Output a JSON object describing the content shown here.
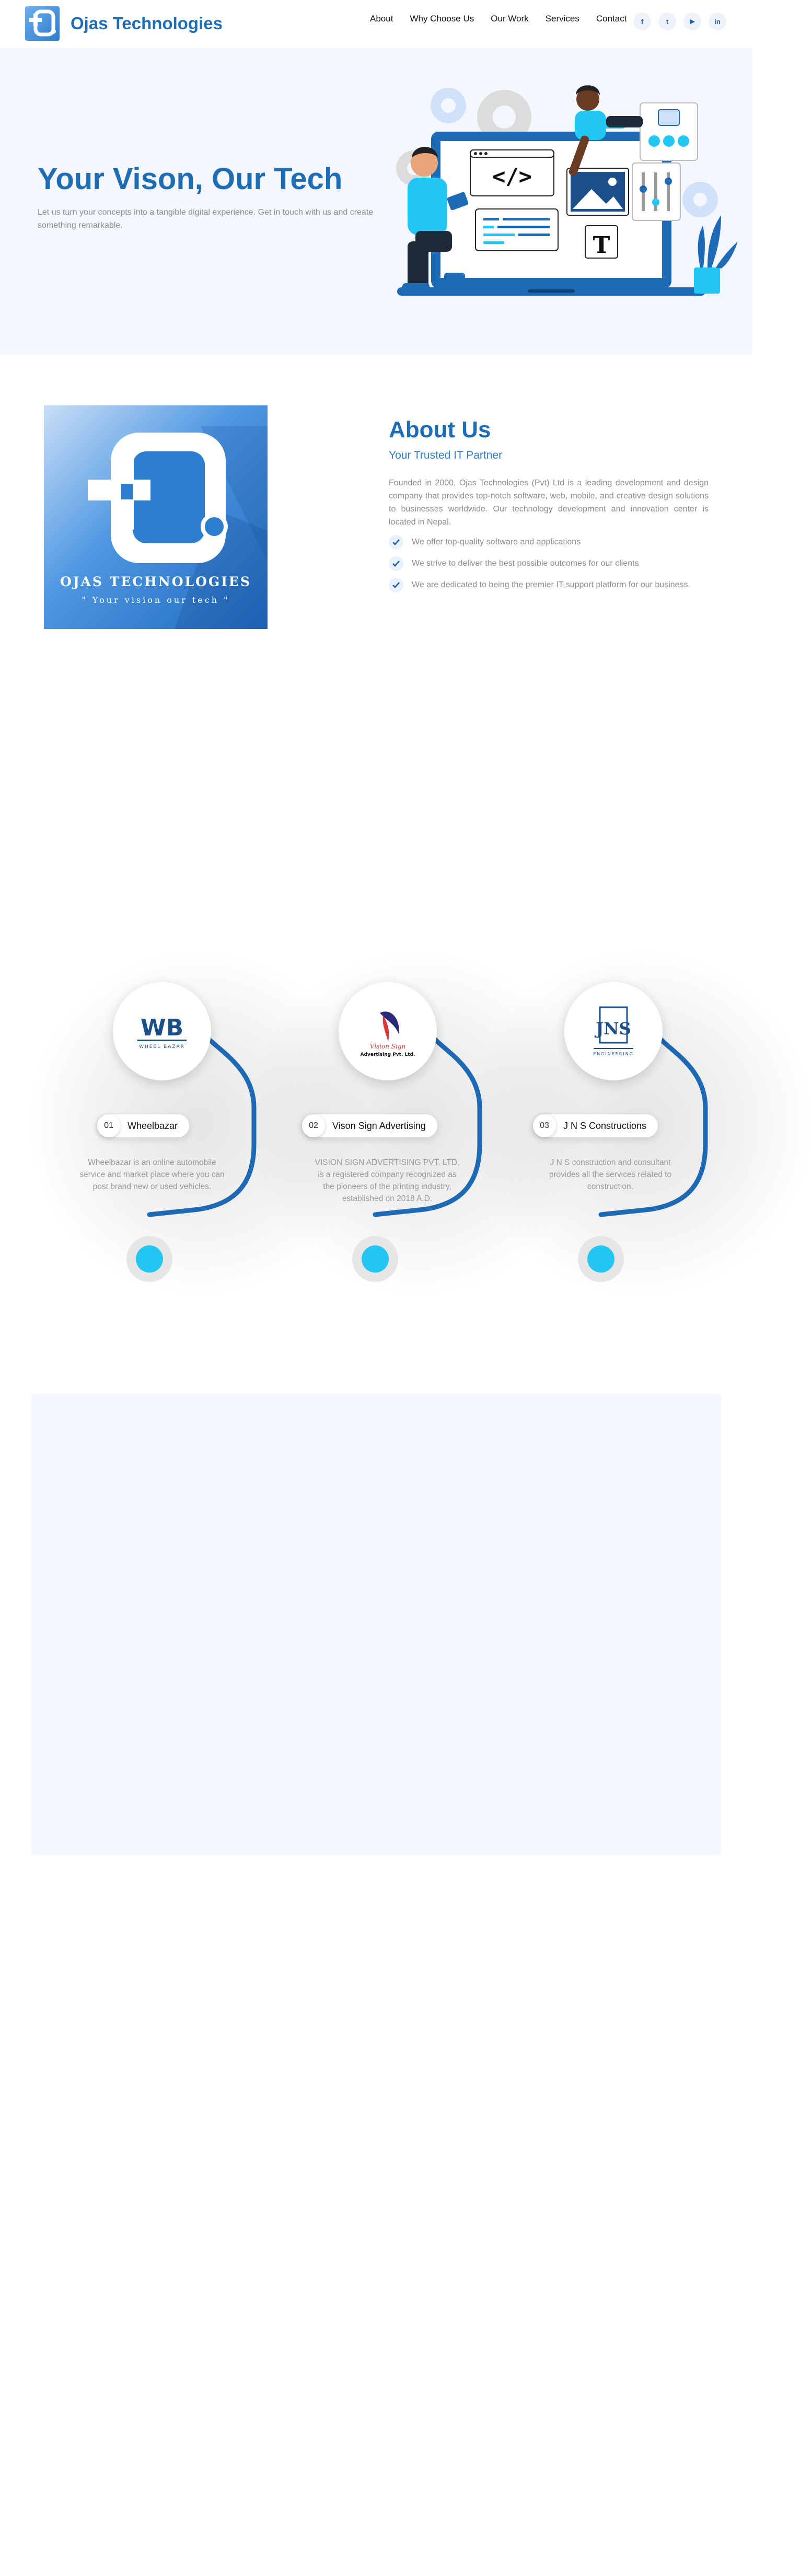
{
  "header": {
    "brand": "Ojas Technologies",
    "nav": [
      "About",
      "Why Choose Us",
      "Our Work",
      "Services",
      "Contact"
    ],
    "social": [
      {
        "icon": "facebook-icon",
        "glyph": "f"
      },
      {
        "icon": "twitter-icon",
        "glyph": "t"
      },
      {
        "icon": "youtube-icon",
        "glyph": "▶"
      },
      {
        "icon": "linkedin-icon",
        "glyph": "in"
      }
    ]
  },
  "hero": {
    "title": "Your Vison, Our Tech",
    "subtitle": "Let us turn your concepts into a tangible digital experience. Get in touch with us and create something remarkable.",
    "code_glyph": "</>",
    "text_glyph": "T"
  },
  "about": {
    "image_brand": "OJAS TECHNOLOGIES",
    "image_tagline": "\" Your vision our tech \"",
    "title": "About Us",
    "subtitle": "Your Trusted IT Partner",
    "description": "Founded in 2000, Ojas Technologies (Pvt) Ltd is a leading development and design company that provides top-notch software, web, mobile, and creative design solutions to businesses worldwide. Our technology development and innovation center is located in Nepal.",
    "points": [
      "We offer top-quality software and applications",
      "We strive to deliver the best possible outcomes for our clients",
      "We are dedicated to being the premier IT support platform for our business."
    ]
  },
  "clients": [
    {
      "num": "01",
      "name": "Wheelbazar",
      "logo_text": "WB",
      "logo_sub": "WHEEL BAZAR",
      "description": "Wheelbazar is an online automobile service and market place where you can post brand new or used vehicles."
    },
    {
      "num": "02",
      "name": "Vison Sign Advertising",
      "logo_text": "Vision Sign",
      "logo_sub": "Advertising Pvt. Ltd.",
      "description": "VISION SIGN ADVERTISING PVT. LTD. is a registered company recognized as the pioneers of the printing industry, established on 2018 A.D."
    },
    {
      "num": "03",
      "name": "J N S Constructions",
      "logo_text": "JNS",
      "logo_sub": "ENGINEERING",
      "description": "J N S construction and consultant provides all the services related to construction."
    }
  ],
  "colors": {
    "brand": "#1f6eb5",
    "accent": "#21c6f2",
    "arc": "#1d69b3",
    "hero_bg": "#f4f8fe"
  }
}
